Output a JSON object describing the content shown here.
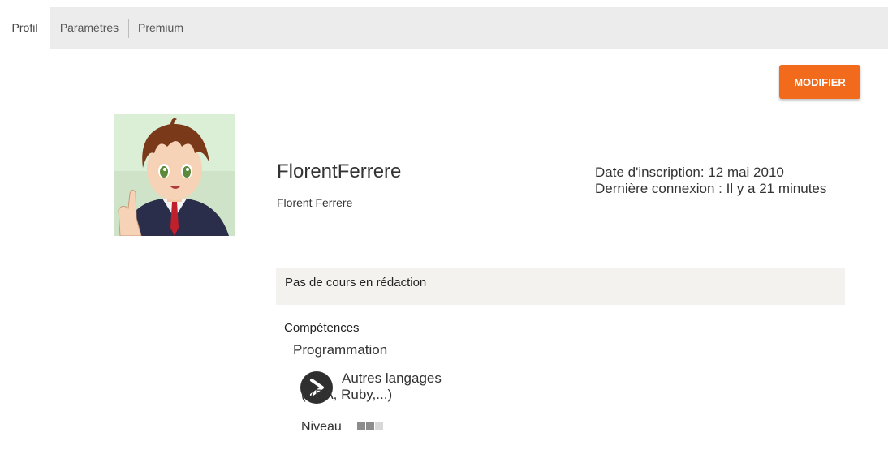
{
  "tabs": [
    {
      "label": "Profil",
      "active": true
    },
    {
      "label": "Paramètres",
      "active": false
    },
    {
      "label": "Premium",
      "active": false
    }
  ],
  "actions": {
    "modify_label": "MODIFIER"
  },
  "profile": {
    "username": "FlorentFerrere",
    "full_name": "Florent Ferrere",
    "registration": "Date d'inscription: 12 mai 2010",
    "last_login": "Dernière connexion : Il y a 21 minutes"
  },
  "drafts": {
    "text": "Pas de cours en rédaction"
  },
  "skills": {
    "title": "Compétences",
    "category": "Programmation",
    "items": [
      {
        "icon": "chevron-right-icon",
        "name": "Autres langages (VBA, Ruby,...)",
        "level_label": "Niveau",
        "level": 2,
        "level_max": 3
      }
    ]
  },
  "colors": {
    "accent": "#f26b1d",
    "tabbar_bg": "#ececec",
    "panel_bg": "#f3f2ef",
    "level_filled": "#8c8c8c",
    "level_empty": "#d8d8d8"
  }
}
